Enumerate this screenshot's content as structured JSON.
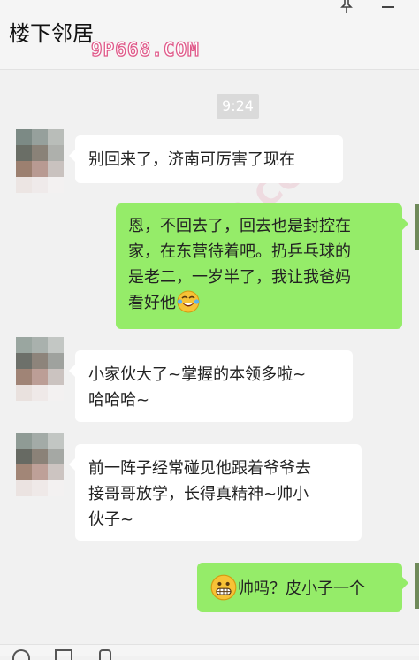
{
  "header": {
    "title": "楼下邻居",
    "watermark": "9P668.COM"
  },
  "timestamp": "9:24",
  "messages": [
    {
      "side": "left",
      "text": "别回来了，济南可厉害了现在"
    },
    {
      "side": "right",
      "lines": [
        "恩，不回去了，回去也是封控在",
        "家，在东营待着吧。扔乒乓球的",
        "是老二，一岁半了，我让我爸妈",
        "看好他"
      ],
      "emoji_after": "laughing-tears"
    },
    {
      "side": "left",
      "lines": [
        "小家伙大了~掌握的本领多啦~",
        "哈哈哈~"
      ]
    },
    {
      "side": "left",
      "lines": [
        "前一阵子经常碰见他跟着爷爷去",
        "接哥哥放学，长得真精神~帅小",
        "伙子~"
      ]
    },
    {
      "side": "right",
      "emoji_before": "grinning",
      "text": "帅吗？皮小子一个"
    }
  ],
  "colors": {
    "background": "#f1f1f1",
    "bubble_left": "#ffffff",
    "bubble_right": "#95ec69",
    "timestamp_bg": "#dadada",
    "watermark_stroke": "#e05a8a"
  },
  "icons": [
    "pin-icon",
    "minimize-icon",
    "avatar-pixelated",
    "laughing-tears-emoji",
    "grinning-emoji",
    "emoji-tool-icon",
    "folder-tool-icon",
    "scissors-tool-icon"
  ]
}
